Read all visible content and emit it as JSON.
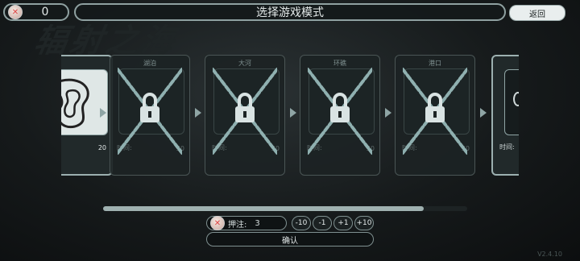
{
  "background_title": "辐射之海",
  "currency": {
    "value": "0"
  },
  "header": {
    "title": "选择游戏模式",
    "back_label": "返回"
  },
  "cards": [
    {
      "name": "",
      "time_label": "",
      "score": "20",
      "locked": false
    },
    {
      "name": "湖泊",
      "time_label": "时间:",
      "score": "20",
      "locked": true
    },
    {
      "name": "大河",
      "time_label": "时间:",
      "score": "20",
      "locked": true
    },
    {
      "name": "环礁",
      "time_label": "时间:",
      "score": "20",
      "locked": true
    },
    {
      "name": "港口",
      "time_label": "时间:",
      "score": "20",
      "locked": true
    },
    {
      "name": "",
      "time_label": "时间:",
      "score": "",
      "locked": false
    }
  ],
  "scroll_progress": 0.88,
  "bet": {
    "label": "押注:",
    "value": "3"
  },
  "bet_steps": [
    "-10",
    "-1",
    "+1",
    "+10"
  ],
  "confirm_label": "确认",
  "version": "V2.4.10",
  "colors": {
    "accent": "#9fb1b0",
    "panel": "#1c2324"
  }
}
